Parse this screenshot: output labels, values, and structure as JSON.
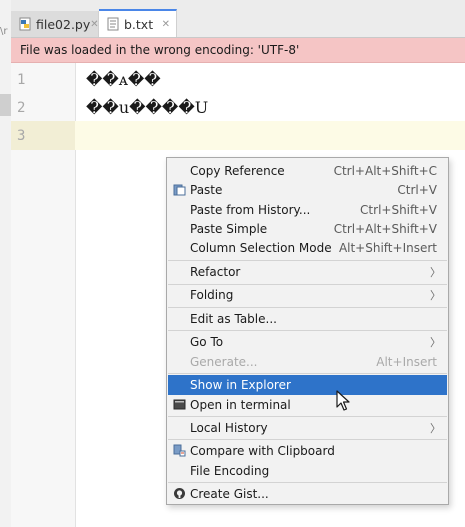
{
  "left_panel": {
    "text_fragment": "\\r"
  },
  "tabs": [
    {
      "label": "file02.py",
      "icon": "python-file-icon",
      "active": false
    },
    {
      "label": "b.txt",
      "icon": "text-file-icon",
      "active": true
    }
  ],
  "banner": {
    "text": "File was loaded in the wrong encoding: 'UTF-8'",
    "color": "#f5c5c5"
  },
  "editor": {
    "line_numbers": [
      "1",
      "2",
      "3"
    ],
    "lines": [
      "��ᴀ��",
      "��u����U",
      ""
    ]
  },
  "menu": {
    "items": [
      {
        "label": "Copy Reference",
        "shortcut": "Ctrl+Alt+Shift+C"
      },
      {
        "label": "Paste",
        "shortcut": "Ctrl+V",
        "icon": "paste-icon"
      },
      {
        "label": "Paste from History...",
        "shortcut": "Ctrl+Shift+V"
      },
      {
        "label": "Paste Simple",
        "shortcut": "Ctrl+Alt+Shift+V"
      },
      {
        "label": "Column Selection Mode",
        "shortcut": "Alt+Shift+Insert"
      },
      {
        "label": "Refactor",
        "submenu": true
      },
      {
        "label": "Folding",
        "submenu": true
      },
      {
        "label": "Edit as Table..."
      },
      {
        "label": "Go To",
        "submenu": true
      },
      {
        "label": "Generate...",
        "shortcut": "Alt+Insert",
        "disabled": true
      },
      {
        "label": "Show in Explorer",
        "selected": true
      },
      {
        "label": "Open in terminal",
        "icon": "terminal-icon"
      },
      {
        "label": "Local History",
        "submenu": true
      },
      {
        "label": "Compare with Clipboard",
        "icon": "compare-icon"
      },
      {
        "label": "File Encoding"
      },
      {
        "label": "Create Gist...",
        "icon": "github-icon"
      }
    ],
    "selected_color": "#2e73c9"
  }
}
